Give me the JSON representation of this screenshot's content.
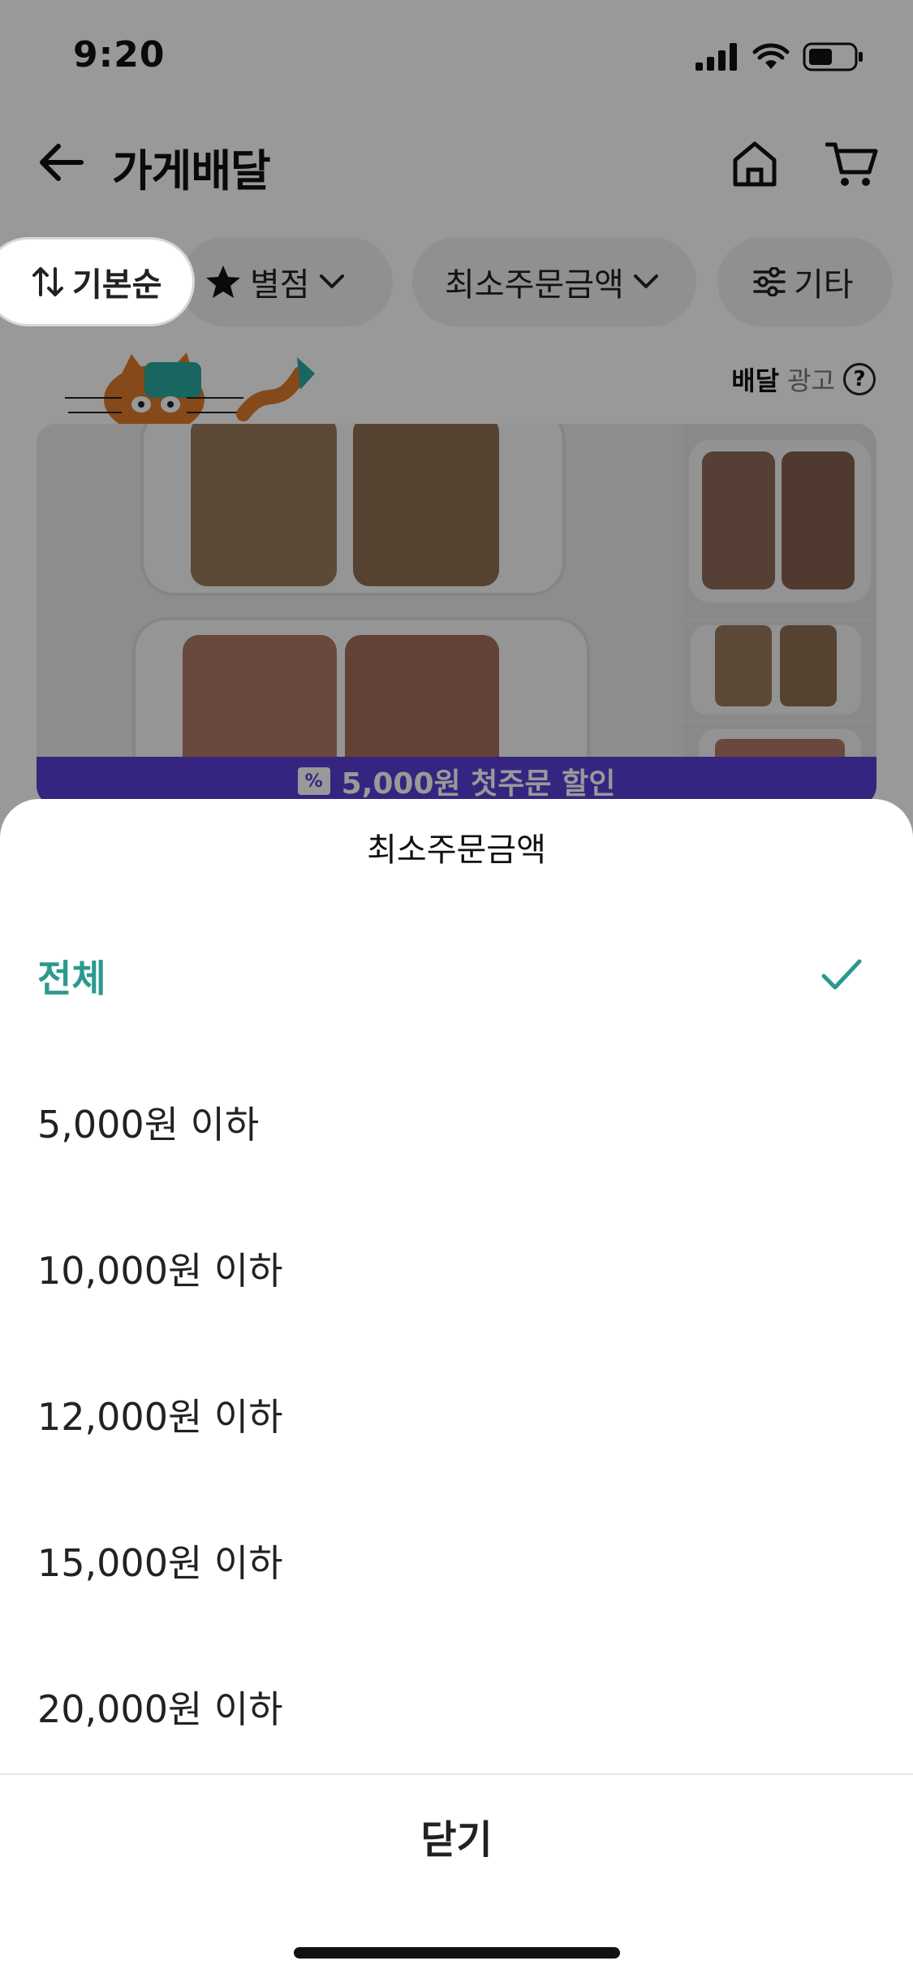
{
  "status_bar": {
    "time": "9:20"
  },
  "nav": {
    "title": "가게배달"
  },
  "filters": {
    "sort_label": "기본순",
    "rating_label": "별점",
    "min_order_label": "최소주문금액",
    "etc_label": "기타"
  },
  "ad_label": {
    "delivery": "배달",
    "ad": "광고",
    "help": "?"
  },
  "store_card": {
    "promo": "5,000원 첫주문 할인",
    "coupon_glyph": "%"
  },
  "sheet": {
    "title": "최소주문금액",
    "options": [
      {
        "label": "전체",
        "selected": true
      },
      {
        "label": "5,000원 이하",
        "selected": false
      },
      {
        "label": "10,000원 이하",
        "selected": false
      },
      {
        "label": "12,000원 이하",
        "selected": false
      },
      {
        "label": "15,000원 이하",
        "selected": false
      },
      {
        "label": "20,000원 이하",
        "selected": false
      }
    ],
    "close_label": "닫기"
  },
  "icons": {
    "back": "arrow-left-icon",
    "home": "home-icon",
    "cart": "cart-icon",
    "sort": "sort-arrows-icon",
    "star": "star-icon",
    "chevron": "chevron-down-icon",
    "sliders": "sliders-icon",
    "check": "check-icon"
  },
  "colors": {
    "accent": "#2b9a8e",
    "promo": "#5a3fd6",
    "overlay": "rgba(0,0,0,0.40)"
  }
}
